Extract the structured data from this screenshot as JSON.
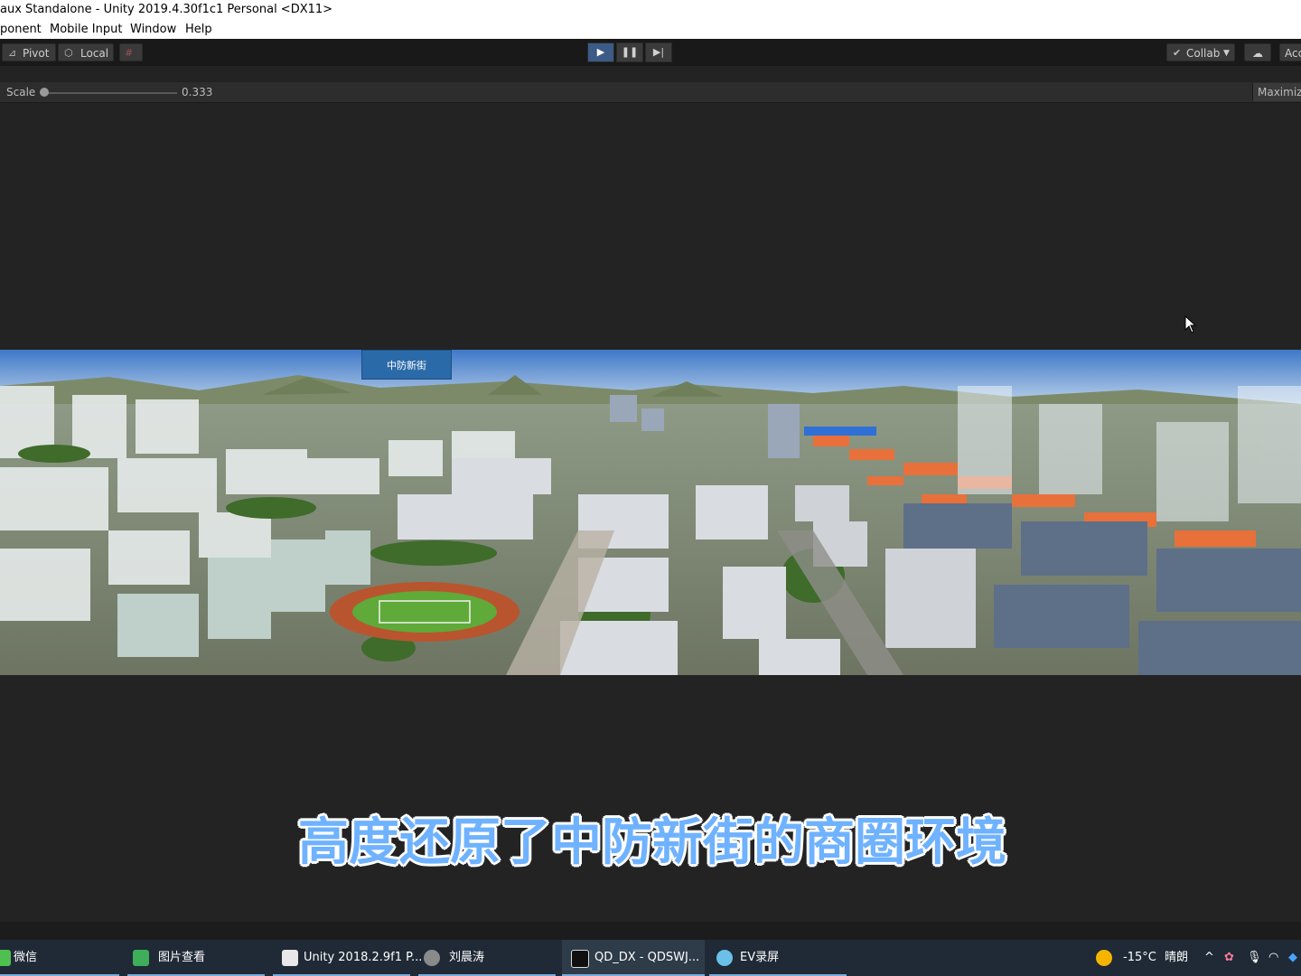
{
  "window": {
    "title": "aux Standalone - Unity 2019.4.30f1c1 Personal <DX11>"
  },
  "menu": {
    "items": [
      "ponent",
      "Mobile Input",
      "Window",
      "Help"
    ]
  },
  "toolbar": {
    "pivot_label": "Pivot",
    "local_label": "Local",
    "collab_label": "Collab",
    "account_label": "Acc"
  },
  "gameview": {
    "scale_label": "Scale",
    "scale_value": "0.333",
    "maximize_label": "Maximize"
  },
  "scene": {
    "watermark_text": "中防新街",
    "subtitle": "高度还原了中防新街的商圈环境"
  },
  "taskbar": {
    "tasks": [
      {
        "label": "微信"
      },
      {
        "label": "图片查看"
      },
      {
        "label": "Unity 2018.2.9f1 P..."
      },
      {
        "label": "刘晨涛"
      },
      {
        "label": "QD_DX - QDSWJ..."
      },
      {
        "label": "EV录屏"
      }
    ],
    "weather": {
      "temperature": "-15°C",
      "condition": "晴朗"
    }
  },
  "colors": {
    "play_active": "#3c5b86",
    "subtitle": "#6fb2ff",
    "roofs": "#e8703a"
  }
}
